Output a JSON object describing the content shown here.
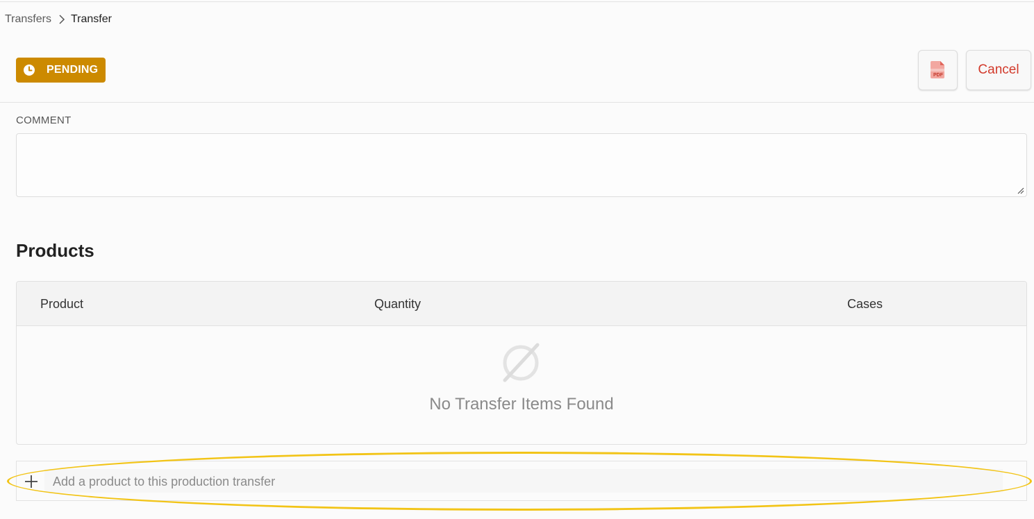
{
  "breadcrumb": {
    "parent": "Transfers",
    "current": "Transfer"
  },
  "status": {
    "label": "PENDING",
    "color": "#cc8a00",
    "icon": "clock-icon"
  },
  "actions": {
    "pdf_icon_text": "PDF",
    "pdf_icon": "pdf-file-icon",
    "cancel_label": "Cancel",
    "cancel_color": "#d23a2b"
  },
  "comment": {
    "label": "COMMENT",
    "value": ""
  },
  "products": {
    "title": "Products",
    "columns": [
      "Product",
      "Quantity",
      "Cases"
    ],
    "rows": [],
    "empty_icon": "empty-set-icon",
    "empty_message": "No Transfer Items Found"
  },
  "add_product": {
    "placeholder": "Add a product to this production transfer",
    "icon": "plus-icon"
  },
  "annotation": {
    "highlight_color": "#f2c417"
  }
}
